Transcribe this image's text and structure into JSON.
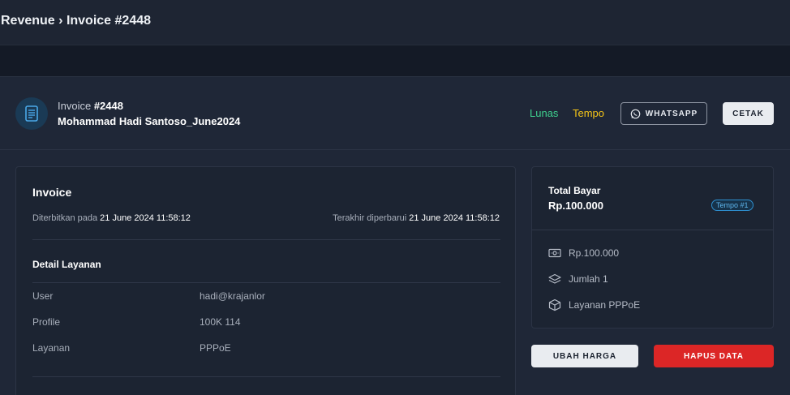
{
  "breadcrumb": {
    "parent": "Revenue",
    "separator": "›",
    "current": "Invoice #2448"
  },
  "header": {
    "invoice_prefix": "Invoice ",
    "invoice_number": "#2448",
    "customer_name": "Mohammad Hadi Santoso_June2024",
    "status_paid": "Lunas",
    "status_tempo": "Tempo",
    "whatsapp_label": "WHATSAPP",
    "print_label": "CETAK",
    "icon": "document-icon"
  },
  "invoice": {
    "title": "Invoice",
    "issued_label": "Diterbitkan pada ",
    "issued_value": "21 June 2024 11:58:12",
    "updated_label": "Terakhir diperbarui ",
    "updated_value": "21 June 2024 11:58:12",
    "section_title": "Detail Layanan",
    "rows": [
      {
        "key": "User",
        "value": "hadi@krajanlor"
      },
      {
        "key": "Profile",
        "value": "100K 114"
      },
      {
        "key": "Layanan",
        "value": "PPPoE"
      }
    ]
  },
  "summary": {
    "total_label": "Total Bayar",
    "total_amount": "Rp.100.000",
    "badge": "Tempo #1",
    "items": [
      {
        "icon": "cash-icon",
        "text": "Rp.100.000"
      },
      {
        "icon": "layers-icon",
        "text": "Jumlah 1"
      },
      {
        "icon": "box-icon",
        "text": "Layanan PPPoE"
      }
    ]
  },
  "actions": {
    "edit_price": "UBAH HARGA",
    "delete": "HAPUS DATA"
  },
  "colors": {
    "accent_paid": "#3ecf8e",
    "accent_tempo": "#f5c518",
    "danger": "#dc2626",
    "badge": "#2e8fcf"
  }
}
